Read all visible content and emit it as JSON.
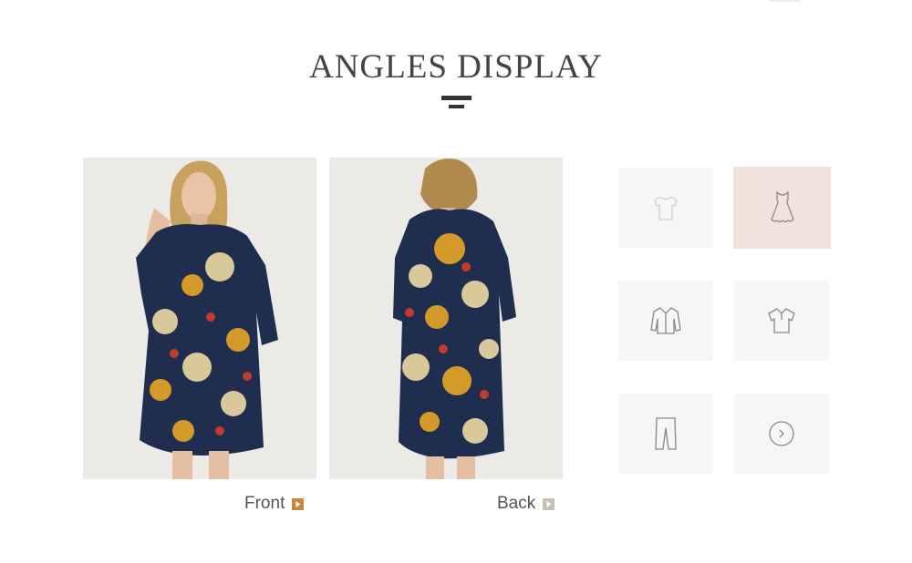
{
  "section": {
    "title": "ANGLES DISPLAY"
  },
  "photos": [
    {
      "caption": "Front",
      "alt": "Front"
    },
    {
      "caption": "Back",
      "alt": "Back"
    }
  ],
  "thumbnails": [
    {
      "icon": "tshirt-icon"
    },
    {
      "icon": "dress-icon",
      "active": true
    },
    {
      "icon": "shirt-icon"
    },
    {
      "icon": "polo-icon"
    },
    {
      "icon": "pants-icon"
    },
    {
      "icon": "chevron-right-icon"
    }
  ],
  "colors": {
    "title": "#444444",
    "caption_text": "#555555",
    "front_play": "#c8893a",
    "back_play": "#c9bfb4",
    "thumb_bg": "#f6f6f6",
    "thumb_active_bg": "#f1e2dc",
    "dress_navy": "#1f2d4e"
  }
}
